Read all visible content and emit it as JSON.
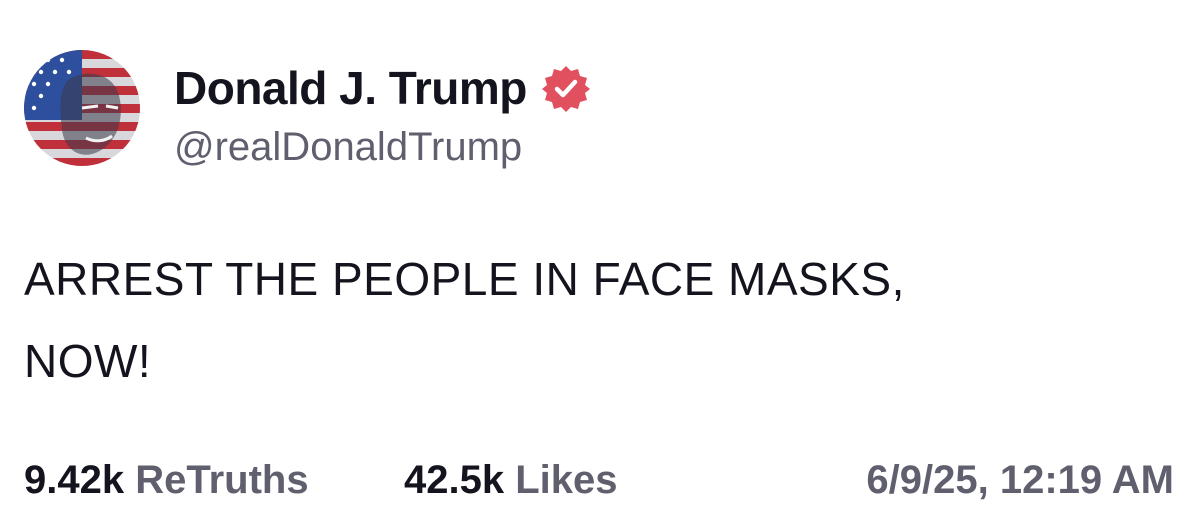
{
  "author": {
    "display_name": "Donald J. Trump",
    "handle": "@realDonaldTrump",
    "verified_icon": "verified-badge-icon",
    "avatar_icon": "avatar-flag-portrait"
  },
  "post": {
    "text": "ARREST THE PEOPLE IN FACE MASKS,\nNOW!"
  },
  "stats": {
    "retruths_count": "9.42k",
    "retruths_label": "ReTruths",
    "likes_count": "42.5k",
    "likes_label": "Likes",
    "timestamp": "6/9/25, 12:19 AM"
  },
  "colors": {
    "verified_badge": "#e0505f",
    "text_primary": "#14141e",
    "text_secondary": "#5f5f6e"
  }
}
